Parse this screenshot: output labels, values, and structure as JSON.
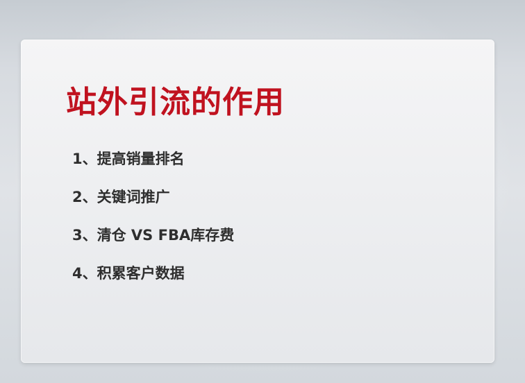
{
  "slide": {
    "title": "站外引流的作用",
    "items": [
      {
        "text": "1、提高销量排名"
      },
      {
        "text": "2、关键词推广"
      },
      {
        "text": "3、清仓 VS FBA库存费"
      },
      {
        "text": "4、积累客户数据"
      }
    ]
  },
  "colors": {
    "title": "#c0121f",
    "body_text": "#2e2e2e",
    "card_background": "#f0f1f3",
    "page_background": "#d7dbe0"
  }
}
